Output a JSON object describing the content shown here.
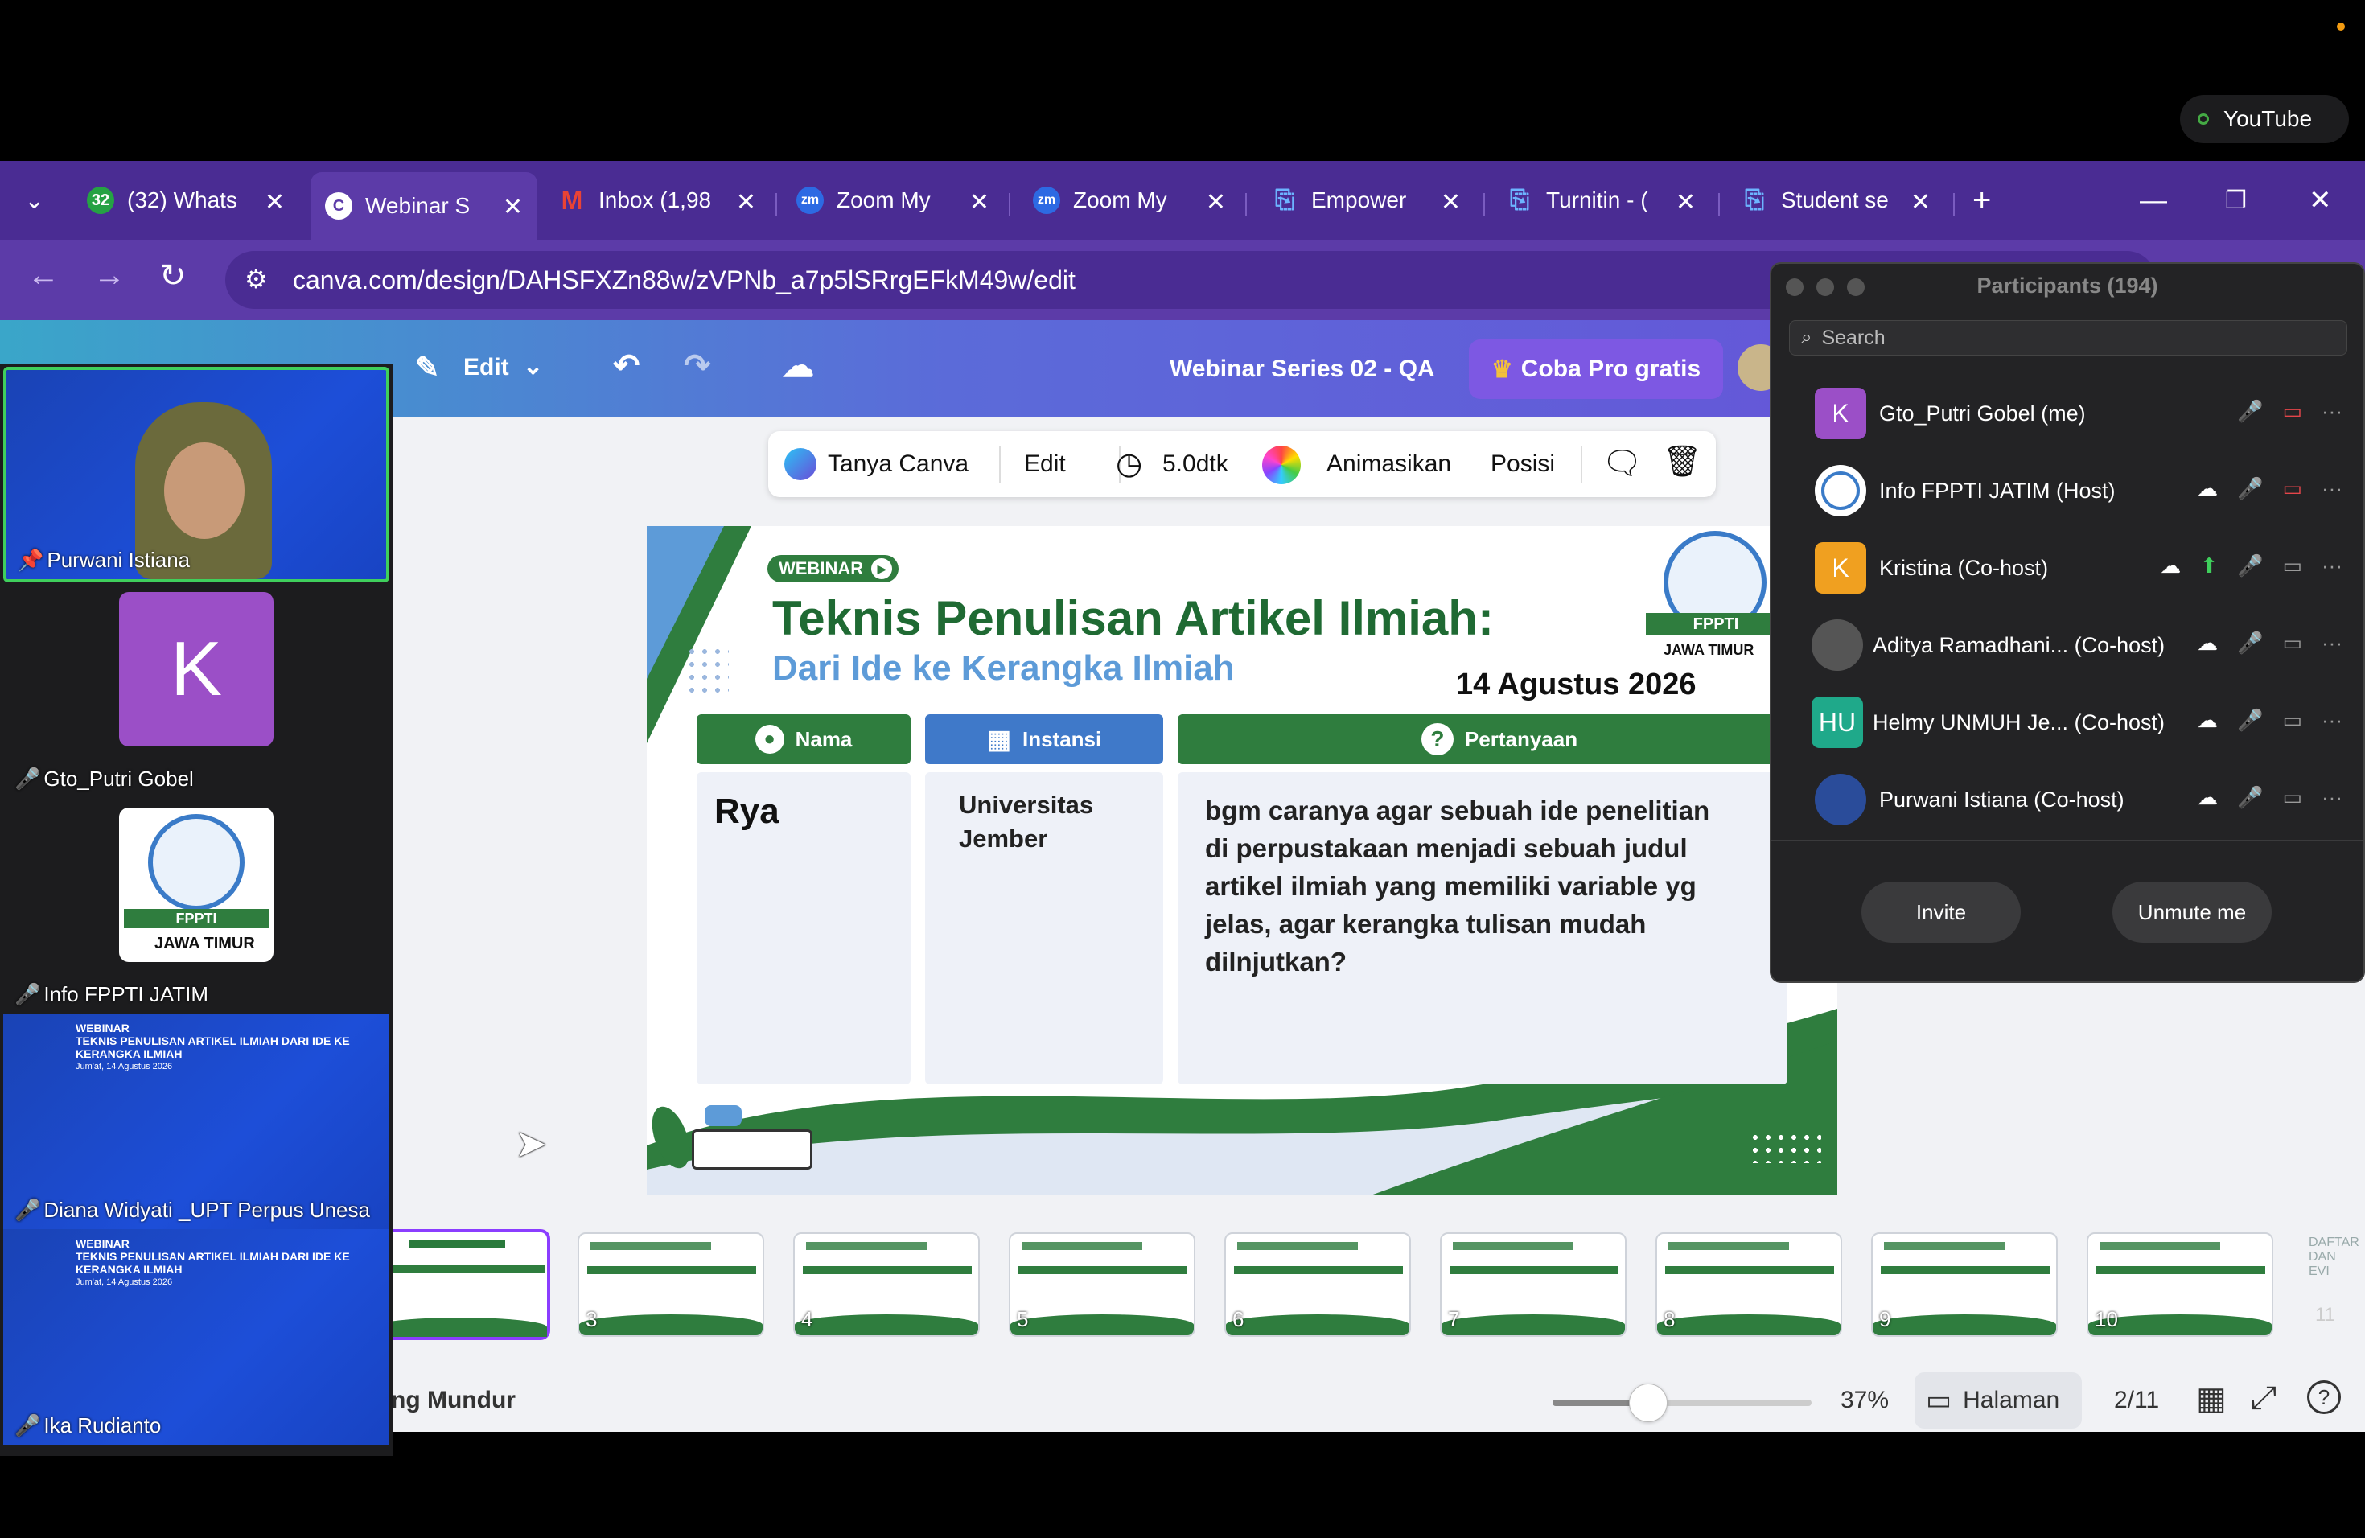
{
  "browser": {
    "youtube_label": "YouTube",
    "tabs": [
      {
        "label": "(32) Whats",
        "icon": "whatsapp-icon",
        "badge": "32"
      },
      {
        "label": "Webinar S",
        "icon": "canva-icon"
      },
      {
        "label": "Inbox (1,98",
        "icon": "gmail-icon"
      },
      {
        "label": "Zoom My",
        "icon": "zoom-icon"
      },
      {
        "label": "Zoom My",
        "icon": "zoom-icon"
      },
      {
        "label": "Empower",
        "icon": "turnitin-icon"
      },
      {
        "label": "Turnitin - (",
        "icon": "turnitin-icon"
      },
      {
        "label": "Student se",
        "icon": "turnitin-icon"
      }
    ],
    "new_tab": "+",
    "url": "canva.com/design/DAHSFXZn88w/zVPNb_a7p5lSRrgEFkM49w/edit"
  },
  "canva": {
    "edit_label": "Edit",
    "doc_title": "Webinar Series 02 - QA",
    "pro_button": "Coba Pro gratis",
    "float_toolbar": {
      "ask": "Tanya Canva",
      "edit": "Edit",
      "duration": "5.0dtk",
      "animate": "Animasikan",
      "position": "Posisi"
    },
    "bottom": {
      "notes_label": "ng Mundur",
      "zoom": "37%",
      "zoom_fraction": 0.37,
      "pages_label": "Halaman",
      "page_indicator": "2/11"
    },
    "thumbnails": [
      "3",
      "4",
      "5",
      "6",
      "7",
      "8",
      "9",
      "10",
      "11"
    ],
    "last_thumb_text": "DAFTAR DAN EVI"
  },
  "slide": {
    "tag": "WEBINAR",
    "title": "Teknis Penulisan Artikel Ilmiah:",
    "subtitle": "Dari Ide ke Kerangka Ilmiah",
    "date": "14 Agustus 2026",
    "logo_text": "FPPTI",
    "logo_sub": "JAWA TIMUR",
    "columns": {
      "name": "Nama",
      "institution": "Instansi",
      "question": "Pertanyaan"
    },
    "name_value": "Rya",
    "institution_value": "Universitas Jember",
    "question_value": "bgm caranya agar sebuah ide penelitian di perpustakaan menjadi sebuah judul artikel ilmiah yang memiliki variable yg jelas, agar kerangka tulisan mudah dilnjutkan?"
  },
  "participants": {
    "title": "Participants (194)",
    "search_placeholder": "Search",
    "items": [
      {
        "initial": "K",
        "name": "Gto_Putri Gobel (me)",
        "color": "#9b4fc7"
      },
      {
        "initial": "",
        "name": "Info FPPTI JATIM (Host)",
        "color": "#ffffff"
      },
      {
        "initial": "K",
        "name": "Kristina (Co-host)",
        "color": "#f0a020"
      },
      {
        "initial": "",
        "name": "Aditya Ramadhani...  (Co-host)",
        "color": "#555555"
      },
      {
        "initial": "HU",
        "name": "Helmy UNMUH Je...  (Co-host)",
        "color": "#1fa98a"
      },
      {
        "initial": "",
        "name": "Purwani Istiana (Co-host)",
        "color": "#2a4c9a"
      }
    ],
    "invite_label": "Invite",
    "unmute_label": "Unmute me"
  },
  "video": {
    "tiles": [
      {
        "name": "Purwani Istiana"
      },
      {
        "name": "Gto_Putri Gobel",
        "initial": "K"
      },
      {
        "name": "Info FPPTI JATIM"
      },
      {
        "name": "Diana Widyati _UPT Perpus Unesa"
      },
      {
        "name": "Ika Rudianto"
      }
    ],
    "banner_title": "WEBINAR",
    "banner_line": "TEKNIS PENULISAN ARTIKEL ILMIAH DARI IDE KE KERANGKA ILMIAH",
    "banner_date": "Jum'at, 14 Agustus 2026"
  },
  "colors": {
    "tab_bar": "#4a2c93",
    "slide_green": "#2f7d3e",
    "zoom_panel": "#232325"
  }
}
